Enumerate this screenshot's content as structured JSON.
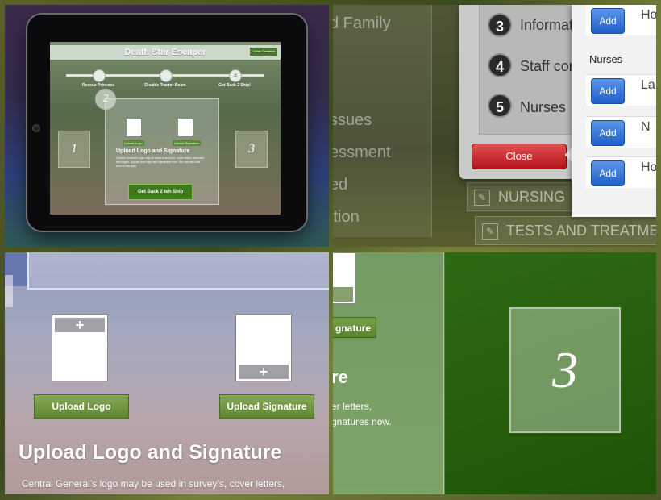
{
  "ipad": {
    "app_title": "Death Star Escaper",
    "title_button": "Cubic Creative",
    "steps": [
      {
        "num": "1",
        "label": "Rescue Princess"
      },
      {
        "num": "2",
        "label": "Disable Tractor Beam"
      },
      {
        "num": "3",
        "label": "Get Back 2 Ship!"
      }
    ],
    "current_step": "2",
    "upload_logo": "Upload Logo",
    "upload_signature": "Upload Signature",
    "heading": "Upload Logo and Signature",
    "body": "Central General's logo may be used in survey's, cover letters, and web site pages. Upload your logo and signatures now. You can also add and do this later.",
    "go_button": "Get Back 2 teh Ship",
    "side_left": "1",
    "side_right": "3"
  },
  "dialog": {
    "bg_items": [
      "d Family",
      "ssues",
      "essment",
      "ed",
      "ition"
    ],
    "numbered_items": [
      {
        "num": "3",
        "label": "Informati"
      },
      {
        "num": "4",
        "label": "Staff con"
      },
      {
        "num": "5",
        "label": "Nurses"
      }
    ],
    "close_button": "Close",
    "popover": {
      "section_header": "Nurses",
      "add_label": "Add",
      "rows": [
        "Ho",
        "La",
        "N",
        "Ho"
      ]
    },
    "tabs": [
      "NURSING",
      "TESTS AND TREATME"
    ]
  },
  "zoom_upload": {
    "upload_logo": "Upload Logo",
    "upload_signature": "Upload Signature",
    "heading": "Upload Logo and Signature",
    "body": "Central General’s logo may be used in survey’s, cover letters,"
  },
  "zoom_step3": {
    "sig_button": "gnature",
    "heading": "re",
    "lines": [
      "er letters,",
      "gnatures now."
    ],
    "step_number": "3"
  }
}
